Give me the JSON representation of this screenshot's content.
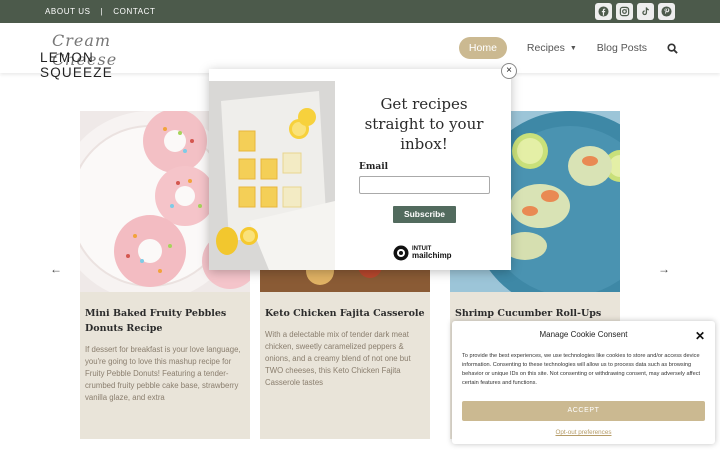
{
  "topbar": {
    "about": "ABOUT US",
    "separator": "|",
    "contact": "CONTACT",
    "social_icons": [
      "facebook-icon",
      "instagram-icon",
      "tiktok-icon",
      "pinterest-icon"
    ]
  },
  "logo": {
    "script": "Cream Cheese",
    "word": "LEMON SQUEEZE"
  },
  "nav": {
    "home": "Home",
    "recipes": "Recipes",
    "blog": "Blog Posts",
    "search_icon": "search-icon"
  },
  "cards": [
    {
      "title": "Mini Baked Fruity Pebbles Donuts Recipe",
      "desc": "If dessert for breakfast is your love language, you're going to love this mashup recipe for Fruity Pebble Donuts! Featuring a tender-crumbed fruity pebble cake base, strawberry vanilla glaze, and extra"
    },
    {
      "title": "Keto Chicken Fajita Casserole",
      "desc": "With a delectable mix of tender dark meat chicken, sweetly caramelized peppers & onions, and a creamy blend of not one but TWO cheeses, this Keto Chicken Fajita Casserole tastes"
    },
    {
      "title": "Shrimp Cucumber Roll-Ups",
      "desc": ""
    }
  ],
  "carousel": {
    "prev": "←",
    "next": "→"
  },
  "popup": {
    "close": "×",
    "heading": "Get recipes straight to your inbox!",
    "email_label": "Email",
    "email_value": "",
    "subscribe": "Subscribe",
    "brand_top": "INTUIT",
    "brand_bottom": "mailchimp"
  },
  "cookie": {
    "title": "Manage Cookie Consent",
    "close": "✕",
    "body": "To provide the best experiences, we use technologies like cookies to store and/or access device information. Consenting to these technologies will allow us to process data such as browsing behavior or unique IDs on this site. Not consenting or withdrawing consent, may adversely affect certain features and functions.",
    "accept": "ACCEPT",
    "optout": "Opt-out preferences"
  },
  "colors": {
    "topbar": "#4c5a4b",
    "accent": "#cbb991",
    "card_bg": "#e9e4d9",
    "subscribe": "#526b5e"
  }
}
